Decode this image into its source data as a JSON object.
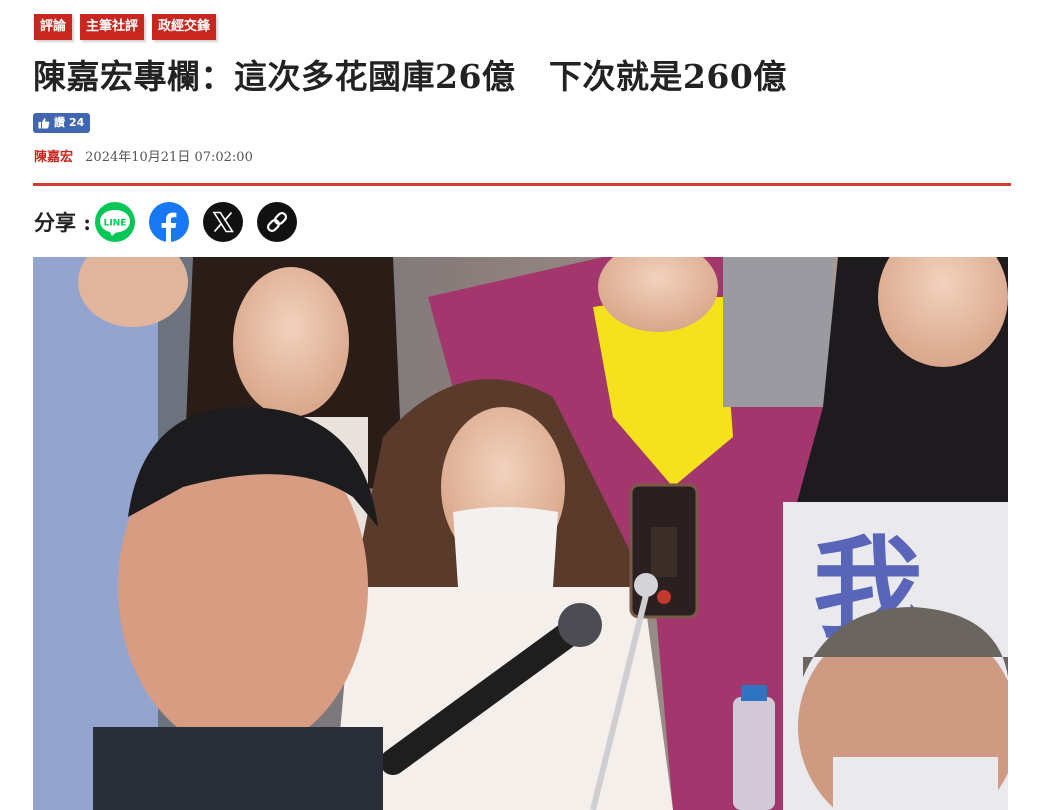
{
  "tags": [
    "評論",
    "主筆社評",
    "政經交鋒"
  ],
  "title": "陳嘉宏專欄：這次多花國庫26億　下次就是260億",
  "like": {
    "label": "讚",
    "count": "24"
  },
  "author": "陳嘉宏",
  "datetime": "2024年10月21日 07:02:00",
  "share": {
    "label": "分享 :",
    "line_label": "LINE",
    "icons": [
      "line-icon",
      "facebook-icon",
      "x-icon",
      "link-icon"
    ]
  },
  "photo": {
    "sign_text": "我"
  },
  "colors": {
    "accent": "#c8271f",
    "rule": "#d23c31",
    "facebook": "#1877f2",
    "line": "#06c755",
    "like_button": "#4267b2"
  }
}
